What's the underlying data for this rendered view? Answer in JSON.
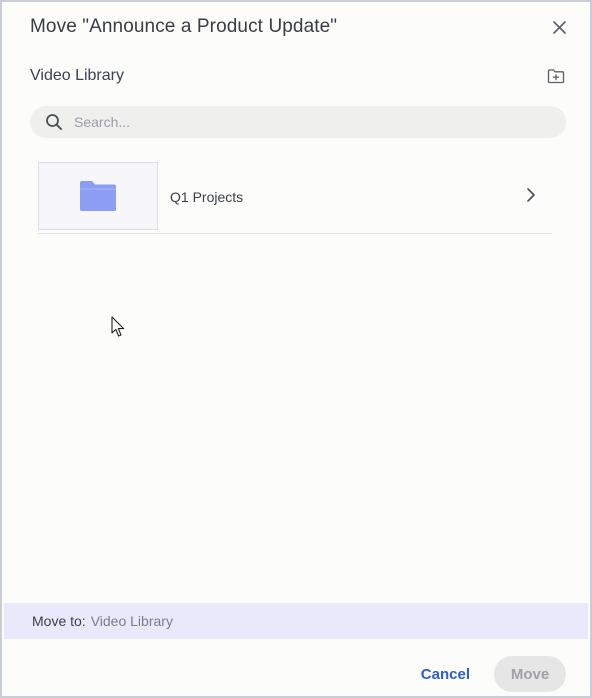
{
  "dialog": {
    "title": "Move \"Announce a Product Update\"",
    "close_icon": "close-icon"
  },
  "location": {
    "label": "Video Library",
    "new_folder_icon": "folder-plus-icon"
  },
  "search": {
    "placeholder": "Search...",
    "value": "",
    "icon": "search-icon"
  },
  "folders": [
    {
      "name": "Q1 Projects",
      "icon": "folder-icon"
    }
  ],
  "footer": {
    "prefix": "Move to:",
    "target": "Video Library"
  },
  "actions": {
    "cancel_label": "Cancel",
    "move_label": "Move"
  },
  "colors": {
    "accent": "#2c5fc9",
    "folder": "#8c9cf2",
    "footer_bg": "#e8eafb"
  }
}
